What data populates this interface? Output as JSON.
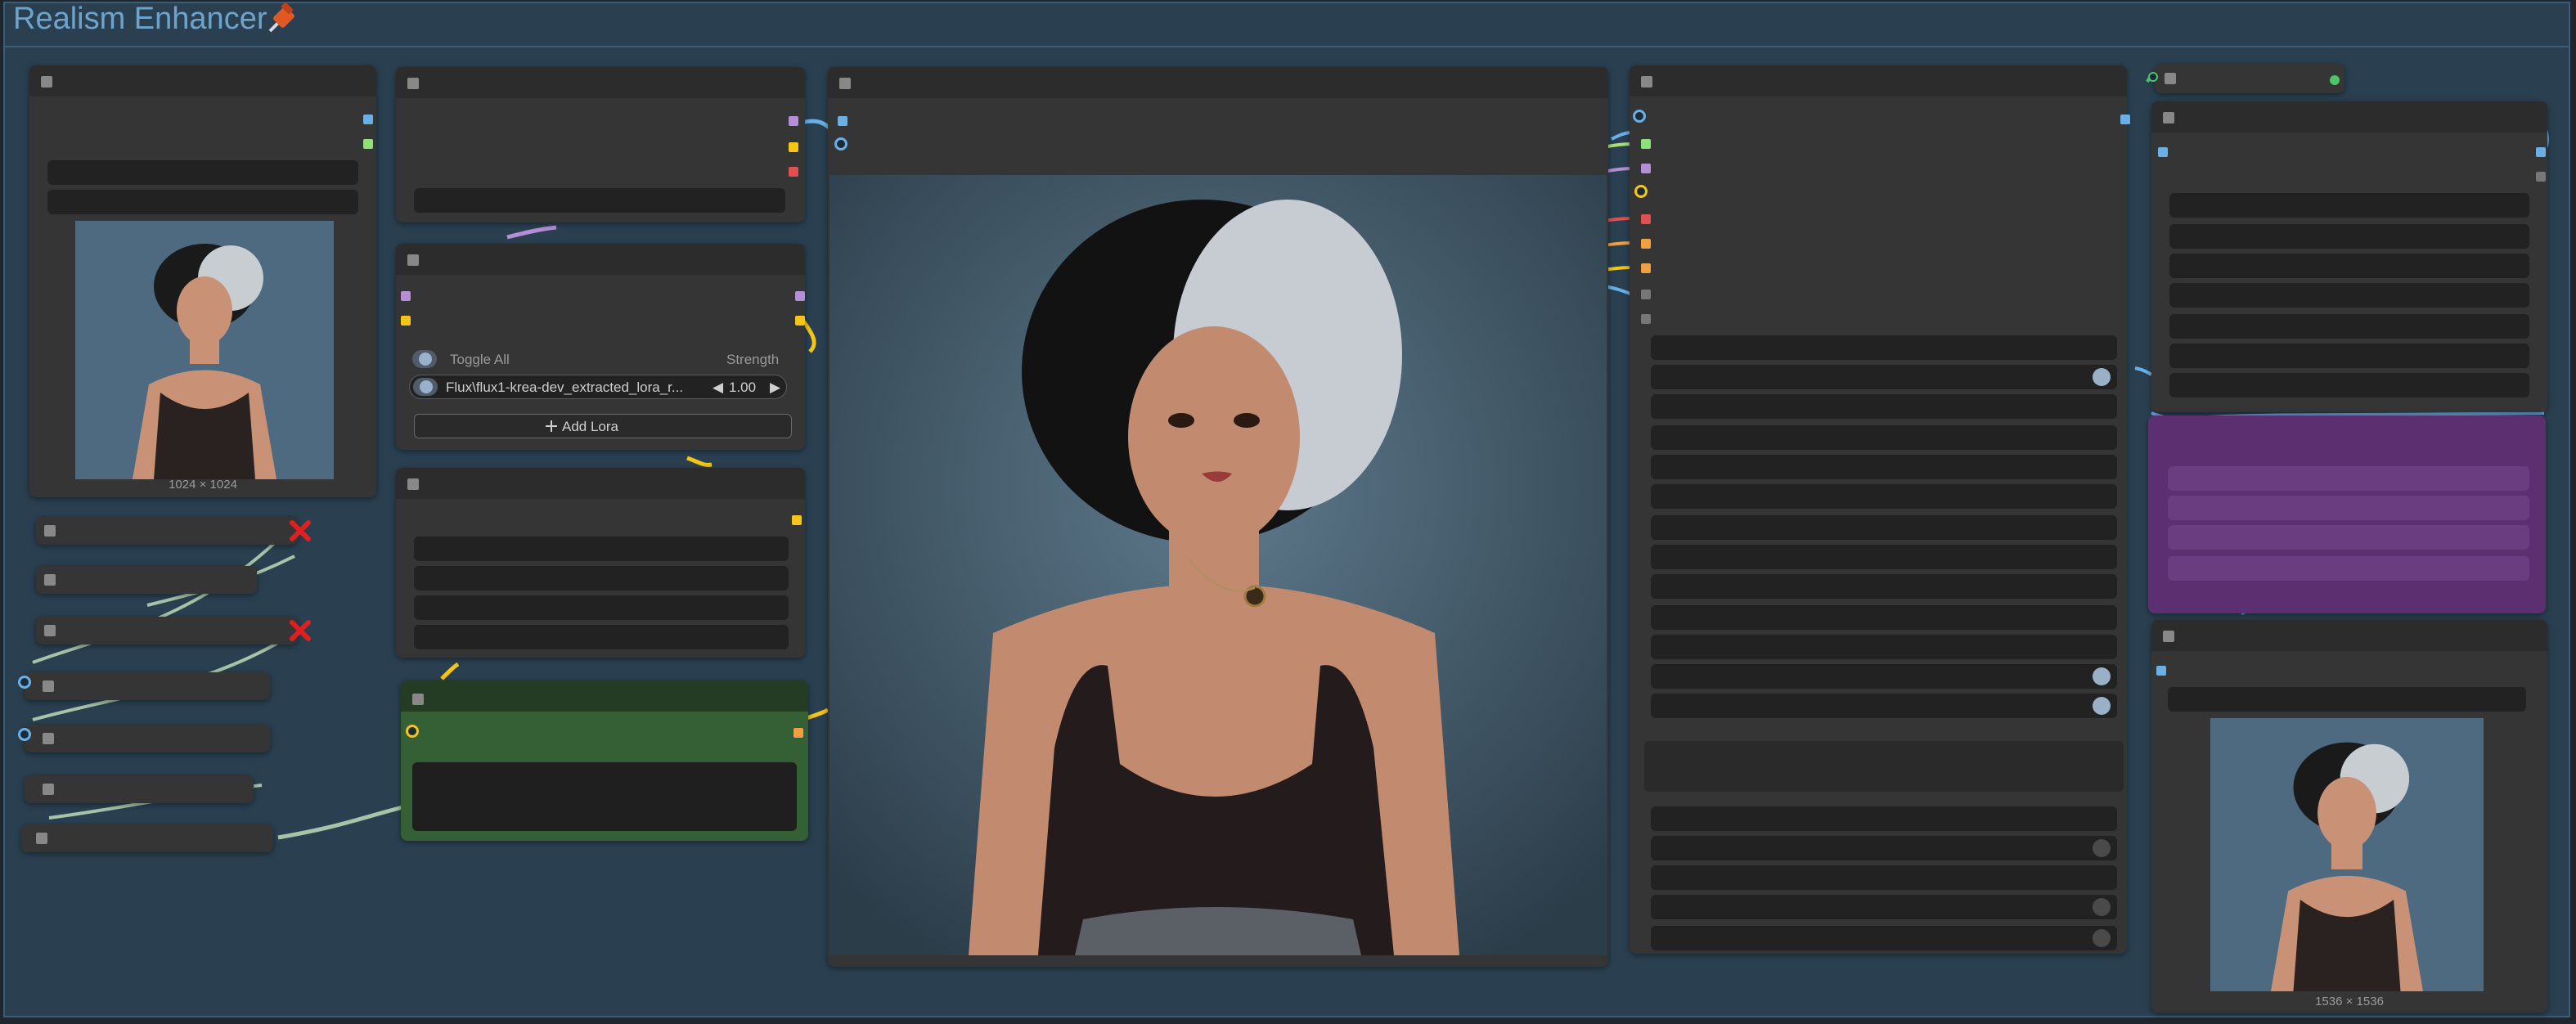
{
  "group": {
    "title": "Realism Enhancer"
  },
  "input_image": {
    "size_label": "1024 × 1024"
  },
  "lora_loader": {
    "toggle_all_label": "Toggle All",
    "strength_header": "Strength",
    "lora_name": "Flux\\flux1-krea-dev_extracted_lora_r...",
    "strength_value": "1.00",
    "add_lora_label": "Add Lora",
    "decrement_arrow": "◀",
    "increment_arrow": "▶"
  },
  "output_image": {
    "size_label": "1536 × 1536"
  },
  "colors": {
    "group_bg": "#2a4051",
    "node_bg": "#353535",
    "green_node": "#2f4f2f",
    "purple_node": "#5a2f6e",
    "link_blue": "#6ab0e6",
    "link_yellow": "#f5c518",
    "link_green": "#a8c4a8",
    "link_purple": "#b48ed6",
    "error_red": "#e02020"
  },
  "icons": [
    "pin-icon",
    "plus-icon",
    "remove-x-icon"
  ]
}
